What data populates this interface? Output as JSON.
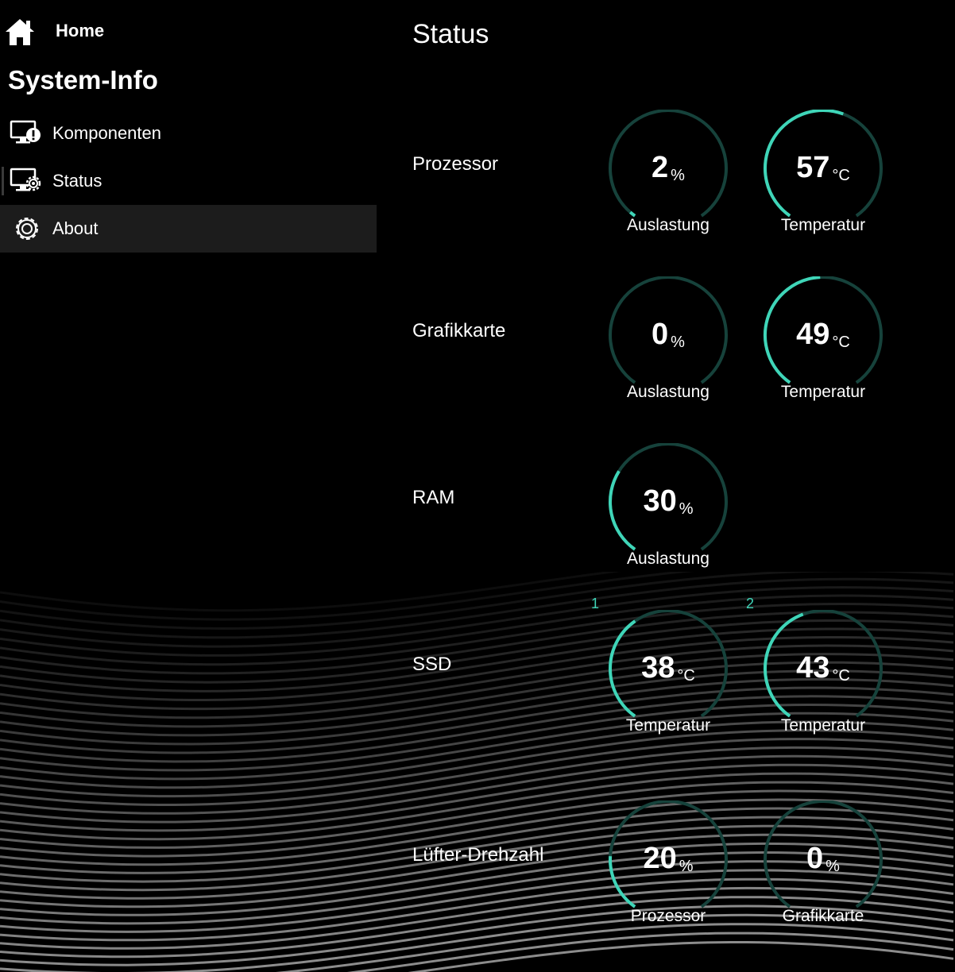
{
  "colors": {
    "accent": "#3fd5b8",
    "track": "#16423b",
    "background": "#000000",
    "hover": "#1c1c1c"
  },
  "sidebar": {
    "home_label": "Home",
    "home_icon": "home-icon",
    "app_title": "System-Info",
    "items": [
      {
        "label": "Komponenten",
        "icon": "monitor-info-icon"
      },
      {
        "label": "Status",
        "icon": "monitor-gear-icon"
      },
      {
        "label": "About",
        "icon": "gear-icon"
      }
    ]
  },
  "main": {
    "title": "Status",
    "rows": [
      {
        "label": "Prozessor",
        "gauges": [
          {
            "value": "2",
            "unit": "%",
            "caption": "Auslastung",
            "fill": 0.02
          },
          {
            "value": "57",
            "unit": "°C",
            "caption": "Temperatur",
            "fill": 0.57
          }
        ]
      },
      {
        "label": "Grafikkarte",
        "gauges": [
          {
            "value": "0",
            "unit": "%",
            "caption": "Auslastung",
            "fill": 0.0
          },
          {
            "value": "49",
            "unit": "°C",
            "caption": "Temperatur",
            "fill": 0.49
          }
        ]
      },
      {
        "label": "RAM",
        "gauges": [
          {
            "value": "30",
            "unit": "%",
            "caption": "Auslastung",
            "fill": 0.3
          }
        ]
      },
      {
        "label": "SSD",
        "disk_labels": [
          "1",
          "2"
        ],
        "gauges": [
          {
            "value": "38",
            "unit": "°C",
            "caption": "Temperatur",
            "fill": 0.38
          },
          {
            "value": "43",
            "unit": "°C",
            "caption": "Temperatur",
            "fill": 0.43
          }
        ]
      },
      {
        "label": "Lüfter-Drehzahl",
        "gauges": [
          {
            "value": "20",
            "unit": "%",
            "caption": "Prozessor",
            "fill": 0.2
          },
          {
            "value": "0",
            "unit": "%",
            "caption": "Grafikkarte",
            "fill": 0.0
          }
        ]
      }
    ]
  }
}
